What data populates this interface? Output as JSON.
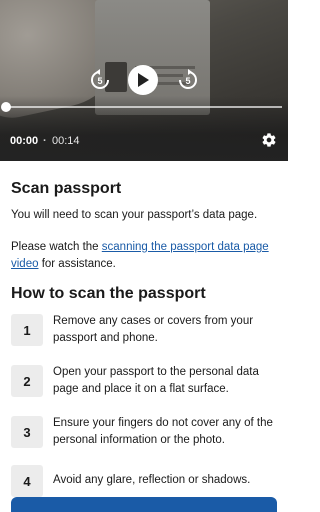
{
  "video": {
    "current_time": "00:00",
    "separator": "·",
    "duration": "00:14",
    "progress": 0,
    "controls": {
      "replay_icon": "replay-5-icon",
      "play_icon": "play-icon",
      "forward_icon": "forward-5-icon",
      "settings_icon": "gear-icon"
    }
  },
  "page": {
    "title": "Scan passport",
    "intro": "You will need to scan your passport’s data page.",
    "watch_prefix": "Please watch the ",
    "watch_link": "scanning the passport data page video",
    "watch_suffix": " for assistance.",
    "how_title": "How to scan the passport"
  },
  "steps": [
    {
      "number": "1",
      "text": "Remove any cases or covers from your passport and phone."
    },
    {
      "number": "2",
      "text": "Open your passport to the personal data page and place it on a flat surface."
    },
    {
      "number": "3",
      "text": "Ensure your fingers do not cover any of the personal information or the photo."
    },
    {
      "number": "4",
      "text": "Avoid any glare, reflection or shadows."
    }
  ],
  "colors": {
    "accent": "#1a5ba7",
    "step_bg": "#ececec",
    "video_bg": "#232323"
  }
}
